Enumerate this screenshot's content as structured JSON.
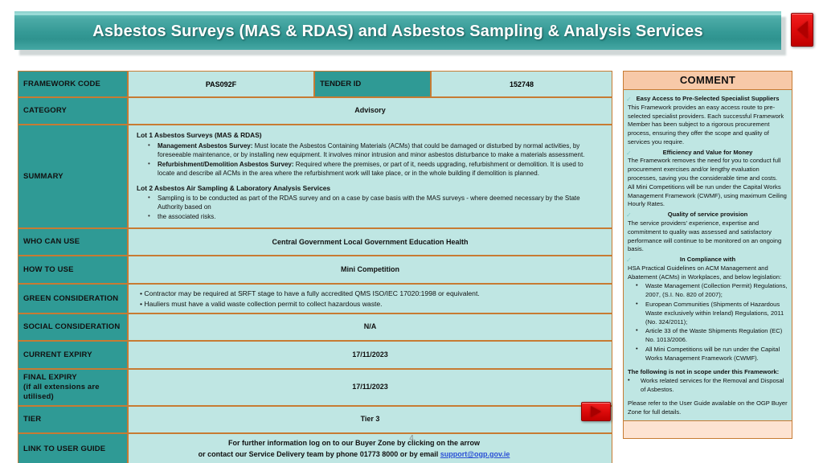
{
  "banner": {
    "title": "Asbestos Surveys (MAS & RDAS) and Asbestos Sampling & Analysis Services",
    "back_icon": "left-triangle-icon",
    "forward_icon": "right-triangle-icon"
  },
  "colors": {
    "banner_teal": "#2f938f",
    "label_teal": "#2f9a95",
    "cell_cyan": "#bfe6e3",
    "border_orange": "#c77b33",
    "comment_peach": "#f7c9a8",
    "button_red": "#e00c0c",
    "link_blue": "#2a4fd6"
  },
  "table": {
    "framework_code_label": "FRAMEWORK CODE",
    "framework_code_value": "PAS092F",
    "tender_id_label": "TENDER ID",
    "tender_id_value": "152748",
    "category_label": "CATEGORY",
    "category_value": "Advisory",
    "summary_label": "SUMMARY",
    "summary": {
      "lot1_heading": "Lot 1 Asbestos Surveys (MAS & RDAS)",
      "lot1_items": [
        {
          "bold": "Management Asbestos Survey:",
          "text": " Must locate the Asbestos Containing Materials (ACMs) that could be damaged or disturbed by normal activities, by foreseeable maintenance, or by installing new equipment. It involves minor intrusion and minor asbestos disturbance to make a materials assessment."
        },
        {
          "bold": "Refurbishment/Demolition Asbestos Survey:",
          "text": " Required where the premises, or part of it, needs upgrading, refurbishment or demolition. It is used to locate and describe all ACMs in the area where the refurbishment work will take place, or in the whole building if demolition is planned."
        }
      ],
      "lot2_heading": "Lot 2 Asbestos Air Sampling & Laboratory Analysis Services",
      "lot2_items": [
        {
          "bold": "",
          "text": "Sampling is to be conducted as part of the RDAS survey and on a case by case basis with the MAS surveys - where deemed necessary by the State Authority based on"
        },
        {
          "bold": "",
          "text": "the associated risks."
        }
      ]
    },
    "who_can_use_label": "WHO CAN USE",
    "who_can_use_value": "Central Government Local Government Education Health",
    "how_to_use_label": "HOW TO USE",
    "how_to_use_value": "Mini Competition",
    "green_label": "GREEN CONSIDERATION",
    "green_items": [
      "• Contractor may be required at SRFT stage to have a fully accredited QMS ISO/IEC 17020:1998 or equivalent.",
      "• Hauliers must have a valid waste collection permit to collect hazardous waste."
    ],
    "social_label": "SOCIAL CONSIDERATION",
    "social_value": "N/A",
    "current_expiry_label": "CURRENT EXPIRY",
    "current_expiry_value": "17/11/2023",
    "final_expiry_label_line1": "FINAL EXPIRY",
    "final_expiry_label_line2": "(if all extensions are utilised)",
    "final_expiry_value": "17/11/2023",
    "tier_label": "TIER",
    "tier_value": "Tier 3",
    "link_label": "LINK TO USER GUIDE",
    "link_line1": "For further information log on to our Buyer Zone by clicking on the arrow",
    "link_line2_pre": "or contact our Service Delivery team by phone  01773 8000 or by email  ",
    "link_email": "support@ogp.gov.ie"
  },
  "comment": {
    "header": "COMMENT",
    "check_icon": "check-icon",
    "sections": [
      {
        "heading": "Easy Access to Pre-Selected Specialist Suppliers",
        "paragraph": "This Framework provides an easy access route to pre-selected specialist providers. Each successful Framework Member has been subject to a rigorous procurement process, ensuring they offer the scope and quality of services you require."
      },
      {
        "heading": "Efficiency and Value for Money",
        "paragraph": "The Framework removes the need for you to conduct full procurement exercises and/or lengthy evaluation processes, saving you the considerable time and costs.",
        "paragraph2": "All Mini Competitions will be run under the Capital Works Management Framework (CWMF), using maximum Ceiling Hourly Rates."
      },
      {
        "heading": "Quality of service provision",
        "paragraph": "The service providers' experience, expertise and commitment to quality was assessed and satisfactory performance will continue to be monitored on an ongoing basis."
      },
      {
        "heading": "In Compliance with",
        "paragraph": "HSA Practical Guidelines on ACM Management and Abatement (ACMs) in Workplaces, and below legislation:"
      }
    ],
    "legislation": [
      "Waste Management (Collection Permit) Regulations, 2007, (S.I. No. 820 of 2007);",
      "European Communities (Shipments of Hazardous Waste exclusively within Ireland) Regulations, 2011 (No. 324/2011);",
      "Article 33 of the Waste Shipments Regulation (EC) No. 1013/2006.",
      "All Mini Competitions will be run under the Capital Works Management Framework (CWMF)."
    ],
    "not_in_scope_heading": "The following is not in scope under this Framework:",
    "not_in_scope_items": [
      "Works related services for the Removal and Disposal of Asbestos."
    ],
    "closing": "Please refer to the User Guide available on the OGP Buyer Zone for full details."
  },
  "footer": {
    "page_number": "4"
  }
}
